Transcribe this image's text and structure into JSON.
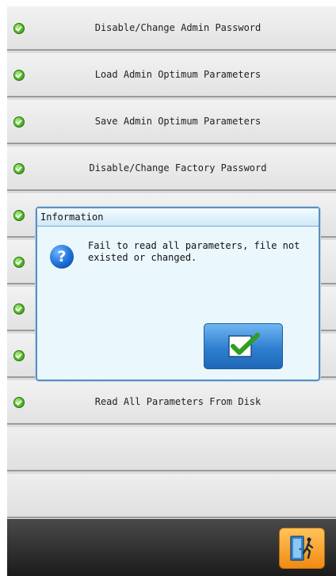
{
  "menu": {
    "items": [
      {
        "label": "Disable/Change Admin Password",
        "icon": "green-check-icon"
      },
      {
        "label": "Load Admin Optimum Parameters",
        "icon": "green-check-icon"
      },
      {
        "label": "Save Admin Optimum Parameters",
        "icon": "green-check-icon"
      },
      {
        "label": "Disable/Change Factory Password",
        "icon": "green-check-icon"
      },
      {
        "label": "",
        "icon": "green-check-icon"
      },
      {
        "label": "",
        "icon": "green-check-icon"
      },
      {
        "label": "",
        "icon": "green-check-icon"
      },
      {
        "label": "",
        "icon": "green-check-icon"
      },
      {
        "label": "Read All Parameters From Disk",
        "icon": "green-check-icon"
      }
    ]
  },
  "dialog": {
    "title": "Information",
    "message": "Fail to read all parameters, file not existed or changed.",
    "icon": "question-icon",
    "ok_icon": "checkmark-icon"
  },
  "bottom_bar": {
    "exit_icon": "exit-door-icon"
  },
  "colors": {
    "dialog_background": "#eaf7fd",
    "dialog_border": "#5b8fc0",
    "ok_button": "#2f7fd0",
    "exit_button": "#f08a10",
    "bullet": "#5ec72e"
  }
}
